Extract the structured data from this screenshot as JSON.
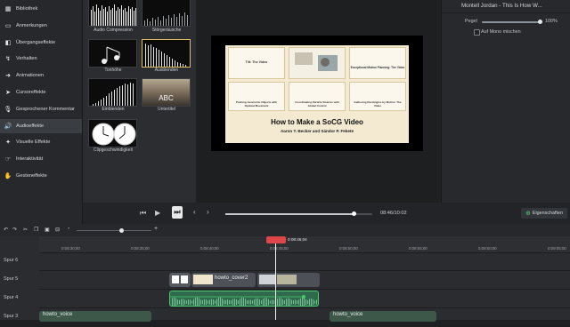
{
  "sidebar": {
    "items": [
      {
        "icon": "library-icon",
        "glyph": "▦",
        "label": "Bibliothek"
      },
      {
        "icon": "annotations-icon",
        "glyph": "▭",
        "label": "Anmerkungen"
      },
      {
        "icon": "transitions-icon",
        "glyph": "◧",
        "label": "Übergangseffekte"
      },
      {
        "icon": "behaviors-icon",
        "glyph": "↯",
        "label": "Verhalten"
      },
      {
        "icon": "animations-icon",
        "glyph": "➜",
        "label": "Animationen"
      },
      {
        "icon": "cursor-effects-icon",
        "glyph": "➤",
        "label": "Cursoreffekte"
      },
      {
        "icon": "narration-icon",
        "glyph": "🎙",
        "label": "Gesprochener Kommentar"
      },
      {
        "icon": "audio-effects-icon",
        "glyph": "🔊",
        "label": "Audioeffekte"
      },
      {
        "icon": "visual-effects-icon",
        "glyph": "✦",
        "label": "Visuelle Effekte"
      },
      {
        "icon": "interactivity-icon",
        "glyph": "☞",
        "label": "Interaktivität"
      },
      {
        "icon": "gesture-effects-icon",
        "glyph": "✋",
        "label": "Gesteneffekte"
      }
    ],
    "active_index": 7
  },
  "library": {
    "tiles": [
      {
        "label": "Audio Compression"
      },
      {
        "label": "Störgeräusche"
      },
      {
        "label": "Tonhöhe"
      },
      {
        "label": "Ausblenden"
      },
      {
        "label": "Einblenden"
      },
      {
        "label": "Untertitel",
        "badge": "ABC"
      },
      {
        "label": "Clipgeschwindigkeit"
      }
    ]
  },
  "canvas": {
    "slide_title": "How to Make a SoCG Video",
    "slide_authors": "Aaron T. Becker and Sándor P. Fekete",
    "panels": [
      {
        "caption": "Tilt: The Video"
      },
      {
        "caption": ""
      },
      {
        "caption": "Exceptional Motion Planning: The Video"
      },
      {
        "caption": "Pushing Geometric Objects with Optimal Movement"
      },
      {
        "caption": "Coordinating Particle Swarms with Global Control"
      },
      {
        "caption": "Gathering Rectangles by Motion: The Video"
      }
    ]
  },
  "properties": {
    "clip_title": "Montell Jordan - This Is How W...",
    "level_label": "Pegel",
    "level_value": "100%",
    "level_fraction": 1.0,
    "mono_label": "Auf Mono mischen",
    "mono_checked": false
  },
  "playback": {
    "time": "08:46/10:02",
    "progress_fraction": 0.874,
    "properties_button": "Eigenschaften"
  },
  "timeline": {
    "playhead_time": "0:08:46;04",
    "ruler_ticks": [
      "0:08:30;00",
      "0:08:35;00",
      "0:08:40;00",
      "0:08:45;00",
      "0:08:50;00",
      "0:08:55;00",
      "0:09:00;00",
      "0:09:05;00"
    ],
    "tracks": [
      {
        "label": "Spur 6"
      },
      {
        "label": "Spur 5"
      },
      {
        "label": "Spur 4"
      },
      {
        "label": "Spur 3"
      }
    ],
    "clips": {
      "cover": "howto_cover2",
      "voice_a": "howto_voice",
      "voice_b": "howto_voice"
    }
  },
  "colors": {
    "accent_green": "#49c96f",
    "selection_yellow": "#e0c05a",
    "playhead_red": "#e0454a",
    "audio_clip": "#2f6a4c"
  }
}
